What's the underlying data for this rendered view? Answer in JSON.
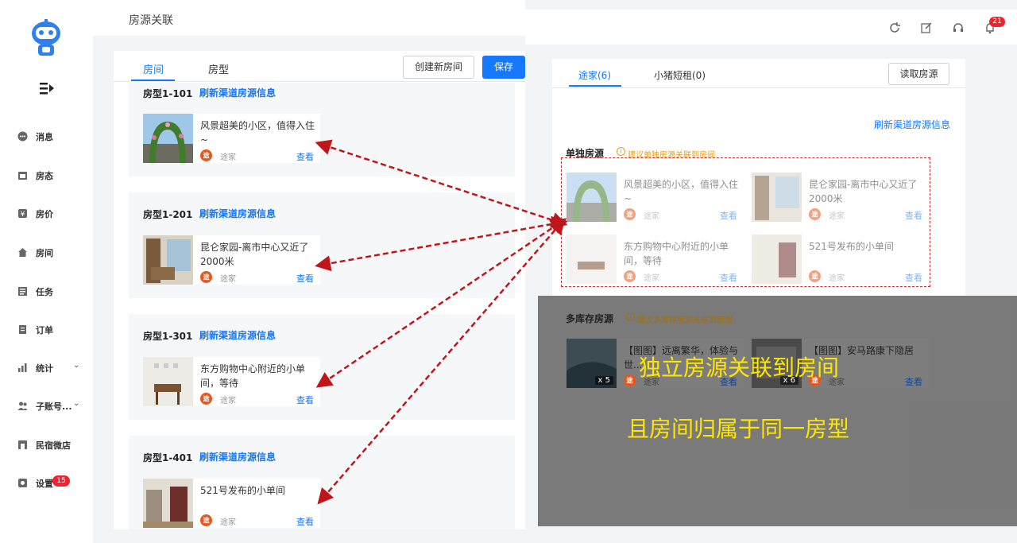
{
  "sidebar": {
    "items": [
      {
        "label": "消息",
        "icon": "message-icon"
      },
      {
        "label": "房态",
        "icon": "calendar-icon"
      },
      {
        "label": "房价",
        "icon": "price-icon"
      },
      {
        "label": "房间",
        "icon": "home-icon"
      },
      {
        "label": "任务",
        "icon": "task-icon"
      },
      {
        "label": "订单",
        "icon": "order-icon"
      },
      {
        "label": "统计",
        "icon": "chart-icon",
        "expand": "⌄"
      },
      {
        "label": "子账号...",
        "icon": "users-icon",
        "expand": "⌄"
      },
      {
        "label": "民宿微店",
        "icon": "shop-icon"
      },
      {
        "label": "设置",
        "icon": "gear-icon",
        "badge": "15"
      }
    ]
  },
  "left": {
    "title": "房源关联",
    "tabs": [
      "房间",
      "房型"
    ],
    "create_button": "创建新房间",
    "save_button": "保存",
    "rooms": [
      {
        "name": "房型1-101",
        "refresh": "刷新渠道房源信息",
        "card": {
          "title": "风景超美的小区，值得入住~",
          "platform": "途家",
          "view": "查看"
        }
      },
      {
        "name": "房型1-201",
        "refresh": "刷新渠道房源信息",
        "card": {
          "title": "昆仑家园-离市中心又近了2000米",
          "platform": "途家",
          "view": "查看"
        }
      },
      {
        "name": "房型1-301",
        "refresh": "刷新渠道房源信息",
        "card": {
          "title": "东方购物中心附近的小单间，等待",
          "platform": "途家",
          "view": "查看"
        }
      },
      {
        "name": "房型1-401",
        "refresh": "刷新渠道房源信息",
        "card": {
          "title": "521号发布的小单间",
          "platform": "途家",
          "view": "查看"
        }
      }
    ]
  },
  "header": {
    "icons": [
      "refresh-icon",
      "edit-icon",
      "headset-icon",
      "bell-icon"
    ],
    "notification_count": "21"
  },
  "right": {
    "tabs": [
      "途家(6)",
      "小猪短租(0)"
    ],
    "read_button": "读取房源",
    "refresh_link": "刷新渠道房源信息",
    "single_section": {
      "title": "单独房源",
      "hint": "建议单独房源关联到房间",
      "cards": [
        {
          "title": "风景超美的小区，值得入住~",
          "platform": "途家",
          "view": "查看"
        },
        {
          "title": "昆仑家园-离市中心又近了2000米",
          "platform": "途家",
          "view": "查看"
        },
        {
          "title": "东方购物中心附近的小单间，等待",
          "platform": "途家",
          "view": "查看"
        },
        {
          "title": "521号发布的小单间",
          "platform": "途家",
          "view": "查看"
        }
      ]
    },
    "multi_section": {
      "title": "多库存房源",
      "hint": "建议多库存房源关联到房型",
      "cards": [
        {
          "title": "【图图】远离繁华，体验与世...",
          "platform": "途家",
          "view": "查看",
          "count": "x 5"
        },
        {
          "title": "【图图】安马路康下隐居",
          "platform": "途家",
          "view": "查看",
          "count": "x 6"
        }
      ]
    }
  },
  "overlay": {
    "line1": "独立房源关联到房间",
    "line2": "且房间归属于同一房型"
  },
  "colors": {
    "accent": "#1677ff",
    "arrow": "#c0161a",
    "overlay_text": "#ffe600",
    "badge": "#f5222d"
  }
}
